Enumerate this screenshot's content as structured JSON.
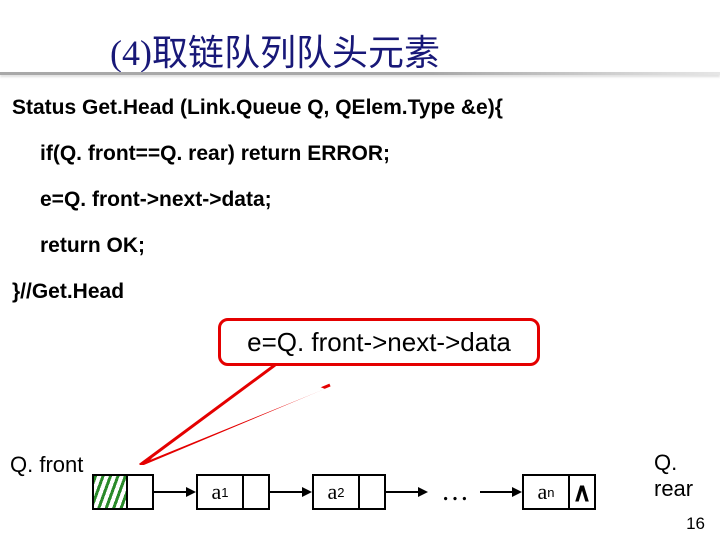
{
  "title": "(4)取链队列队头元素",
  "code": {
    "l1": "Status Get.Head (Link.Queue Q, QElem.Type &e){",
    "l2": "if(Q. front==Q. rear) return ERROR;",
    "l3": "e=Q. front->next->data;",
    "l4": "return OK;",
    "l5": "}//Get.Head"
  },
  "callout": "e=Q. front->next->data",
  "list": {
    "qfront": "Q. front",
    "qrear": "Q. rear",
    "a_prefix": "a",
    "sub1": "1",
    "sub2": "2",
    "subn": "n",
    "dots": "…",
    "null_symbol": "∧"
  },
  "page_number": "16"
}
